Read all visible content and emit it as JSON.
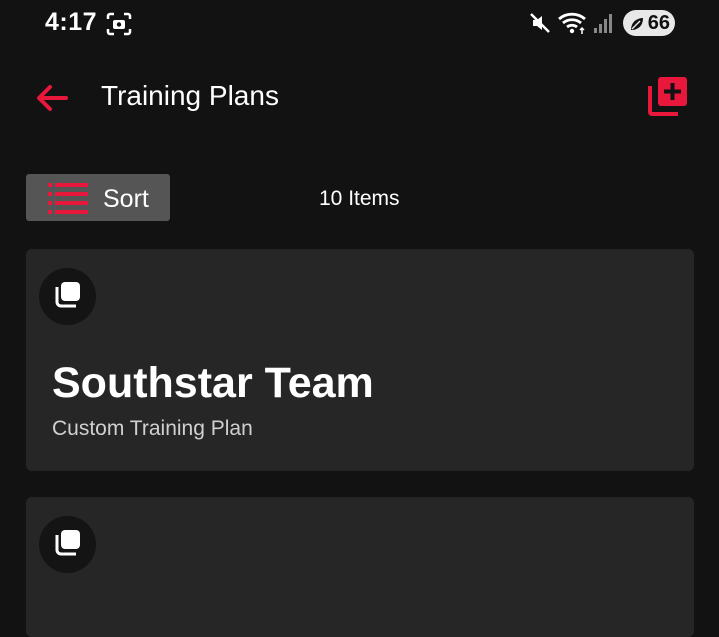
{
  "status_bar": {
    "time": "4:17",
    "battery": "66"
  },
  "app_bar": {
    "title": "Training Plans"
  },
  "toolbar": {
    "sort_label": "Sort",
    "items_count": "10 Items"
  },
  "plans": [
    {
      "title": "Southstar Team",
      "subtitle": "Custom Training Plan"
    },
    {
      "title": "",
      "subtitle": ""
    }
  ],
  "colors": {
    "accent": "#e8173c",
    "background": "#121212",
    "card": "#262626",
    "sort_button": "#555555"
  }
}
